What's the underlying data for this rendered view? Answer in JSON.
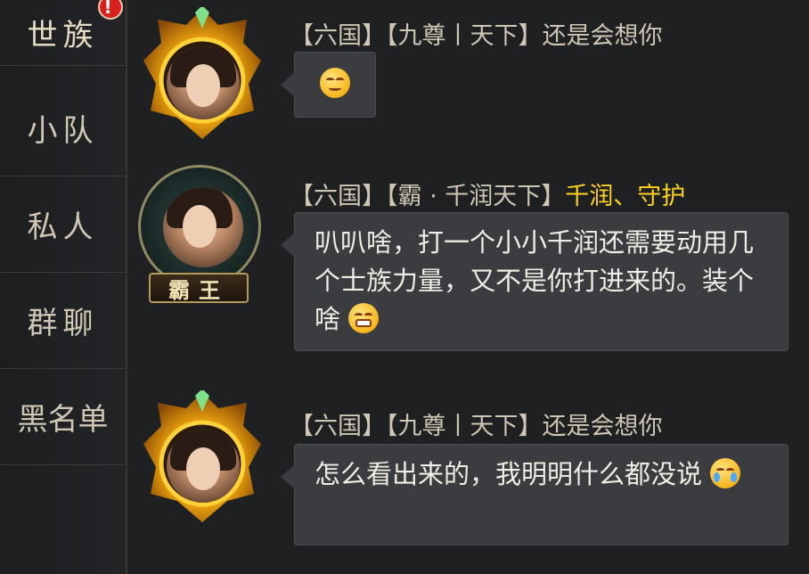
{
  "sidebar": {
    "tabs": [
      {
        "label": "世族",
        "badge": "!"
      },
      {
        "label": "小队"
      },
      {
        "label": "私人"
      },
      {
        "label": "群聊"
      },
      {
        "label": "黑名单"
      }
    ]
  },
  "messages": [
    {
      "sender_prefix": "【六国】【九尊丨天下】还是会想你",
      "text": "",
      "emoji": "smile-emoji"
    },
    {
      "sender_prefix": "【六国】【霸 · 千润天下】",
      "sender_highlight": "千润、守护",
      "avatar_plate": "霸王",
      "text": "叭叭啥，打一个小小千润还需要动用几个士族力量，又不是你打进来的。装个啥",
      "emoji": "grin-emoji"
    },
    {
      "sender_prefix": "【六国】【九尊丨天下】还是会想你",
      "text": "怎么看出来的，我明明什么都没说",
      "emoji": "cry-emoji"
    }
  ],
  "colors": {
    "background": "#1f2022",
    "bubble": "#3a3c3f",
    "highlight": "#ffd21f",
    "badge": "#d8201c"
  }
}
